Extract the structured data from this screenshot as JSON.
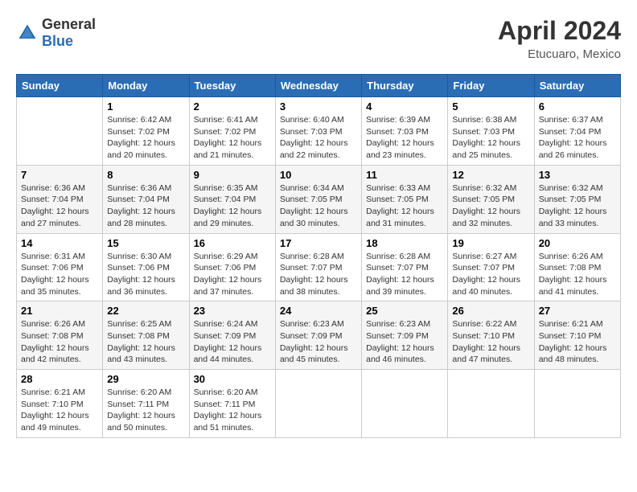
{
  "header": {
    "logo_general": "General",
    "logo_blue": "Blue",
    "month": "April 2024",
    "location": "Etucuaro, Mexico"
  },
  "days_of_week": [
    "Sunday",
    "Monday",
    "Tuesday",
    "Wednesday",
    "Thursday",
    "Friday",
    "Saturday"
  ],
  "weeks": [
    [
      {
        "day": "",
        "sunrise": "",
        "sunset": "",
        "daylight": ""
      },
      {
        "day": "1",
        "sunrise": "Sunrise: 6:42 AM",
        "sunset": "Sunset: 7:02 PM",
        "daylight": "Daylight: 12 hours and 20 minutes."
      },
      {
        "day": "2",
        "sunrise": "Sunrise: 6:41 AM",
        "sunset": "Sunset: 7:02 PM",
        "daylight": "Daylight: 12 hours and 21 minutes."
      },
      {
        "day": "3",
        "sunrise": "Sunrise: 6:40 AM",
        "sunset": "Sunset: 7:03 PM",
        "daylight": "Daylight: 12 hours and 22 minutes."
      },
      {
        "day": "4",
        "sunrise": "Sunrise: 6:39 AM",
        "sunset": "Sunset: 7:03 PM",
        "daylight": "Daylight: 12 hours and 23 minutes."
      },
      {
        "day": "5",
        "sunrise": "Sunrise: 6:38 AM",
        "sunset": "Sunset: 7:03 PM",
        "daylight": "Daylight: 12 hours and 25 minutes."
      },
      {
        "day": "6",
        "sunrise": "Sunrise: 6:37 AM",
        "sunset": "Sunset: 7:04 PM",
        "daylight": "Daylight: 12 hours and 26 minutes."
      }
    ],
    [
      {
        "day": "7",
        "sunrise": "Sunrise: 6:36 AM",
        "sunset": "Sunset: 7:04 PM",
        "daylight": "Daylight: 12 hours and 27 minutes."
      },
      {
        "day": "8",
        "sunrise": "Sunrise: 6:36 AM",
        "sunset": "Sunset: 7:04 PM",
        "daylight": "Daylight: 12 hours and 28 minutes."
      },
      {
        "day": "9",
        "sunrise": "Sunrise: 6:35 AM",
        "sunset": "Sunset: 7:04 PM",
        "daylight": "Daylight: 12 hours and 29 minutes."
      },
      {
        "day": "10",
        "sunrise": "Sunrise: 6:34 AM",
        "sunset": "Sunset: 7:05 PM",
        "daylight": "Daylight: 12 hours and 30 minutes."
      },
      {
        "day": "11",
        "sunrise": "Sunrise: 6:33 AM",
        "sunset": "Sunset: 7:05 PM",
        "daylight": "Daylight: 12 hours and 31 minutes."
      },
      {
        "day": "12",
        "sunrise": "Sunrise: 6:32 AM",
        "sunset": "Sunset: 7:05 PM",
        "daylight": "Daylight: 12 hours and 32 minutes."
      },
      {
        "day": "13",
        "sunrise": "Sunrise: 6:32 AM",
        "sunset": "Sunset: 7:05 PM",
        "daylight": "Daylight: 12 hours and 33 minutes."
      }
    ],
    [
      {
        "day": "14",
        "sunrise": "Sunrise: 6:31 AM",
        "sunset": "Sunset: 7:06 PM",
        "daylight": "Daylight: 12 hours and 35 minutes."
      },
      {
        "day": "15",
        "sunrise": "Sunrise: 6:30 AM",
        "sunset": "Sunset: 7:06 PM",
        "daylight": "Daylight: 12 hours and 36 minutes."
      },
      {
        "day": "16",
        "sunrise": "Sunrise: 6:29 AM",
        "sunset": "Sunset: 7:06 PM",
        "daylight": "Daylight: 12 hours and 37 minutes."
      },
      {
        "day": "17",
        "sunrise": "Sunrise: 6:28 AM",
        "sunset": "Sunset: 7:07 PM",
        "daylight": "Daylight: 12 hours and 38 minutes."
      },
      {
        "day": "18",
        "sunrise": "Sunrise: 6:28 AM",
        "sunset": "Sunset: 7:07 PM",
        "daylight": "Daylight: 12 hours and 39 minutes."
      },
      {
        "day": "19",
        "sunrise": "Sunrise: 6:27 AM",
        "sunset": "Sunset: 7:07 PM",
        "daylight": "Daylight: 12 hours and 40 minutes."
      },
      {
        "day": "20",
        "sunrise": "Sunrise: 6:26 AM",
        "sunset": "Sunset: 7:08 PM",
        "daylight": "Daylight: 12 hours and 41 minutes."
      }
    ],
    [
      {
        "day": "21",
        "sunrise": "Sunrise: 6:26 AM",
        "sunset": "Sunset: 7:08 PM",
        "daylight": "Daylight: 12 hours and 42 minutes."
      },
      {
        "day": "22",
        "sunrise": "Sunrise: 6:25 AM",
        "sunset": "Sunset: 7:08 PM",
        "daylight": "Daylight: 12 hours and 43 minutes."
      },
      {
        "day": "23",
        "sunrise": "Sunrise: 6:24 AM",
        "sunset": "Sunset: 7:09 PM",
        "daylight": "Daylight: 12 hours and 44 minutes."
      },
      {
        "day": "24",
        "sunrise": "Sunrise: 6:23 AM",
        "sunset": "Sunset: 7:09 PM",
        "daylight": "Daylight: 12 hours and 45 minutes."
      },
      {
        "day": "25",
        "sunrise": "Sunrise: 6:23 AM",
        "sunset": "Sunset: 7:09 PM",
        "daylight": "Daylight: 12 hours and 46 minutes."
      },
      {
        "day": "26",
        "sunrise": "Sunrise: 6:22 AM",
        "sunset": "Sunset: 7:10 PM",
        "daylight": "Daylight: 12 hours and 47 minutes."
      },
      {
        "day": "27",
        "sunrise": "Sunrise: 6:21 AM",
        "sunset": "Sunset: 7:10 PM",
        "daylight": "Daylight: 12 hours and 48 minutes."
      }
    ],
    [
      {
        "day": "28",
        "sunrise": "Sunrise: 6:21 AM",
        "sunset": "Sunset: 7:10 PM",
        "daylight": "Daylight: 12 hours and 49 minutes."
      },
      {
        "day": "29",
        "sunrise": "Sunrise: 6:20 AM",
        "sunset": "Sunset: 7:11 PM",
        "daylight": "Daylight: 12 hours and 50 minutes."
      },
      {
        "day": "30",
        "sunrise": "Sunrise: 6:20 AM",
        "sunset": "Sunset: 7:11 PM",
        "daylight": "Daylight: 12 hours and 51 minutes."
      },
      {
        "day": "",
        "sunrise": "",
        "sunset": "",
        "daylight": ""
      },
      {
        "day": "",
        "sunrise": "",
        "sunset": "",
        "daylight": ""
      },
      {
        "day": "",
        "sunrise": "",
        "sunset": "",
        "daylight": ""
      },
      {
        "day": "",
        "sunrise": "",
        "sunset": "",
        "daylight": ""
      }
    ]
  ]
}
